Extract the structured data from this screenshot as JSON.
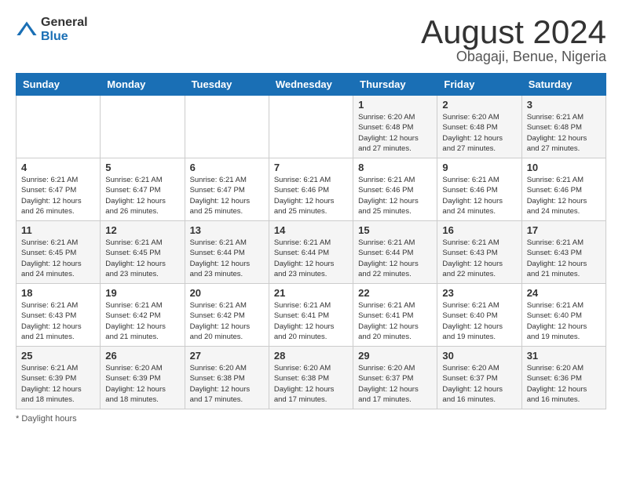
{
  "logo": {
    "general": "General",
    "blue": "Blue"
  },
  "title": "August 2024",
  "subtitle": "Obagaji, Benue, Nigeria",
  "days": [
    "Sunday",
    "Monday",
    "Tuesday",
    "Wednesday",
    "Thursday",
    "Friday",
    "Saturday"
  ],
  "weeks": [
    [
      {
        "day": "",
        "info": ""
      },
      {
        "day": "",
        "info": ""
      },
      {
        "day": "",
        "info": ""
      },
      {
        "day": "",
        "info": ""
      },
      {
        "day": "1",
        "info": "Sunrise: 6:20 AM\nSunset: 6:48 PM\nDaylight: 12 hours\nand 27 minutes."
      },
      {
        "day": "2",
        "info": "Sunrise: 6:20 AM\nSunset: 6:48 PM\nDaylight: 12 hours\nand 27 minutes."
      },
      {
        "day": "3",
        "info": "Sunrise: 6:21 AM\nSunset: 6:48 PM\nDaylight: 12 hours\nand 27 minutes."
      }
    ],
    [
      {
        "day": "4",
        "info": "Sunrise: 6:21 AM\nSunset: 6:47 PM\nDaylight: 12 hours\nand 26 minutes."
      },
      {
        "day": "5",
        "info": "Sunrise: 6:21 AM\nSunset: 6:47 PM\nDaylight: 12 hours\nand 26 minutes."
      },
      {
        "day": "6",
        "info": "Sunrise: 6:21 AM\nSunset: 6:47 PM\nDaylight: 12 hours\nand 25 minutes."
      },
      {
        "day": "7",
        "info": "Sunrise: 6:21 AM\nSunset: 6:46 PM\nDaylight: 12 hours\nand 25 minutes."
      },
      {
        "day": "8",
        "info": "Sunrise: 6:21 AM\nSunset: 6:46 PM\nDaylight: 12 hours\nand 25 minutes."
      },
      {
        "day": "9",
        "info": "Sunrise: 6:21 AM\nSunset: 6:46 PM\nDaylight: 12 hours\nand 24 minutes."
      },
      {
        "day": "10",
        "info": "Sunrise: 6:21 AM\nSunset: 6:46 PM\nDaylight: 12 hours\nand 24 minutes."
      }
    ],
    [
      {
        "day": "11",
        "info": "Sunrise: 6:21 AM\nSunset: 6:45 PM\nDaylight: 12 hours\nand 24 minutes."
      },
      {
        "day": "12",
        "info": "Sunrise: 6:21 AM\nSunset: 6:45 PM\nDaylight: 12 hours\nand 23 minutes."
      },
      {
        "day": "13",
        "info": "Sunrise: 6:21 AM\nSunset: 6:44 PM\nDaylight: 12 hours\nand 23 minutes."
      },
      {
        "day": "14",
        "info": "Sunrise: 6:21 AM\nSunset: 6:44 PM\nDaylight: 12 hours\nand 23 minutes."
      },
      {
        "day": "15",
        "info": "Sunrise: 6:21 AM\nSunset: 6:44 PM\nDaylight: 12 hours\nand 22 minutes."
      },
      {
        "day": "16",
        "info": "Sunrise: 6:21 AM\nSunset: 6:43 PM\nDaylight: 12 hours\nand 22 minutes."
      },
      {
        "day": "17",
        "info": "Sunrise: 6:21 AM\nSunset: 6:43 PM\nDaylight: 12 hours\nand 21 minutes."
      }
    ],
    [
      {
        "day": "18",
        "info": "Sunrise: 6:21 AM\nSunset: 6:43 PM\nDaylight: 12 hours\nand 21 minutes."
      },
      {
        "day": "19",
        "info": "Sunrise: 6:21 AM\nSunset: 6:42 PM\nDaylight: 12 hours\nand 21 minutes."
      },
      {
        "day": "20",
        "info": "Sunrise: 6:21 AM\nSunset: 6:42 PM\nDaylight: 12 hours\nand 20 minutes."
      },
      {
        "day": "21",
        "info": "Sunrise: 6:21 AM\nSunset: 6:41 PM\nDaylight: 12 hours\nand 20 minutes."
      },
      {
        "day": "22",
        "info": "Sunrise: 6:21 AM\nSunset: 6:41 PM\nDaylight: 12 hours\nand 20 minutes."
      },
      {
        "day": "23",
        "info": "Sunrise: 6:21 AM\nSunset: 6:40 PM\nDaylight: 12 hours\nand 19 minutes."
      },
      {
        "day": "24",
        "info": "Sunrise: 6:21 AM\nSunset: 6:40 PM\nDaylight: 12 hours\nand 19 minutes."
      }
    ],
    [
      {
        "day": "25",
        "info": "Sunrise: 6:21 AM\nSunset: 6:39 PM\nDaylight: 12 hours\nand 18 minutes."
      },
      {
        "day": "26",
        "info": "Sunrise: 6:20 AM\nSunset: 6:39 PM\nDaylight: 12 hours\nand 18 minutes."
      },
      {
        "day": "27",
        "info": "Sunrise: 6:20 AM\nSunset: 6:38 PM\nDaylight: 12 hours\nand 17 minutes."
      },
      {
        "day": "28",
        "info": "Sunrise: 6:20 AM\nSunset: 6:38 PM\nDaylight: 12 hours\nand 17 minutes."
      },
      {
        "day": "29",
        "info": "Sunrise: 6:20 AM\nSunset: 6:37 PM\nDaylight: 12 hours\nand 17 minutes."
      },
      {
        "day": "30",
        "info": "Sunrise: 6:20 AM\nSunset: 6:37 PM\nDaylight: 12 hours\nand 16 minutes."
      },
      {
        "day": "31",
        "info": "Sunrise: 6:20 AM\nSunset: 6:36 PM\nDaylight: 12 hours\nand 16 minutes."
      }
    ]
  ],
  "footer": "* Daylight hours"
}
